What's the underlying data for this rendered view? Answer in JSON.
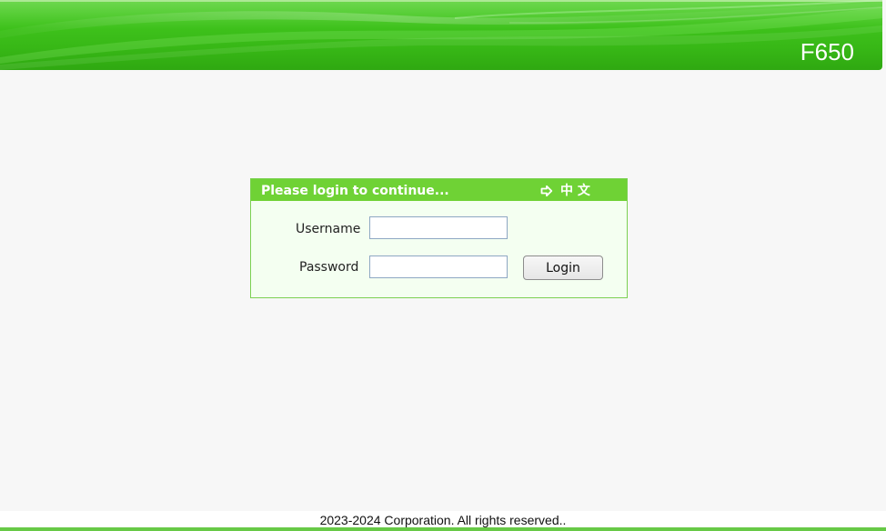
{
  "header": {
    "product": "F650"
  },
  "login": {
    "title": "Please login to continue...",
    "language_label": "中 文",
    "language_icon": "arrow-right-icon",
    "username_label": "Username",
    "password_label": "Password",
    "username_value": "",
    "password_value": "",
    "login_button": "Login"
  },
  "footer": {
    "copyright": "2023-2024 Corporation. All rights reserved.."
  },
  "colors": {
    "header_green": "#3fc31c",
    "panel_green": "#6fd235",
    "panel_background": "#f4fff1",
    "footer_line": "#67c946"
  }
}
